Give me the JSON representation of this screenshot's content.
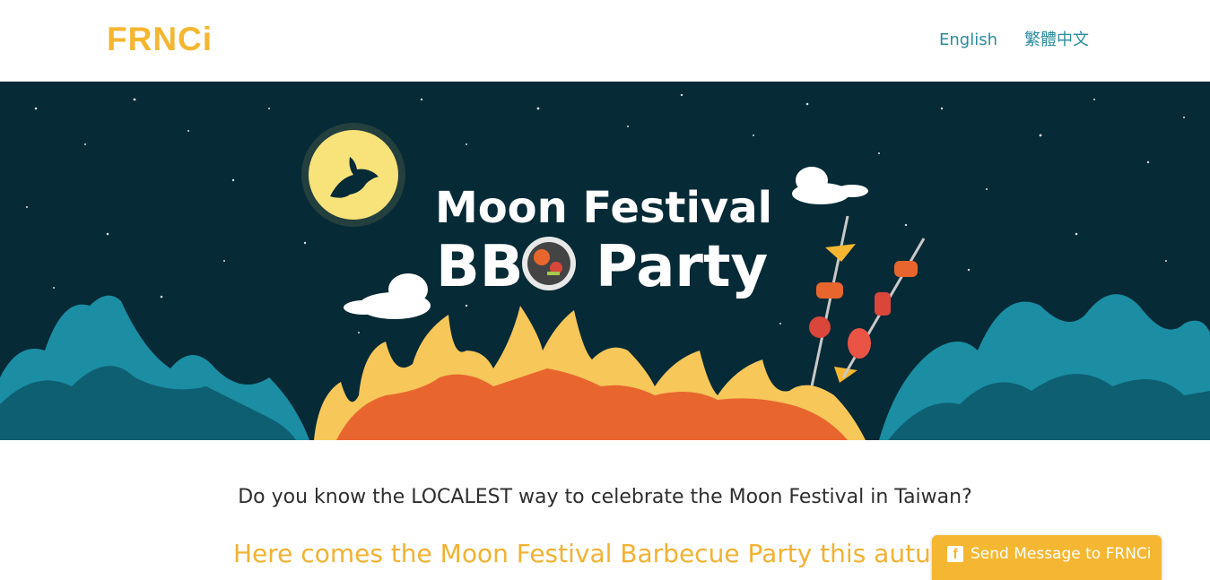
{
  "header": {
    "logo_text": "FRNCi",
    "lang_english": "English",
    "lang_chinese": "繁體中文"
  },
  "banner": {
    "title_line1": "Moon Festival",
    "title_line2_a": "BB",
    "title_line2_b": "Party",
    "colors": {
      "sky": "#062a36",
      "moon": "#f8e27a",
      "mountain_light": "#1b8ea4",
      "mountain_dark": "#0e5f72",
      "flame_outer": "#f7c75a",
      "flame_inner": "#e8662e"
    }
  },
  "content": {
    "question": "Do you know the LOCALEST way to celebrate the Moon Festival in Taiwan?",
    "headline": "Here comes the Moon Festival Barbecue Party this autumn"
  },
  "messenger": {
    "label": "Send Message to FRNCi",
    "icon": "facebook-icon",
    "color": "#f5b731"
  }
}
